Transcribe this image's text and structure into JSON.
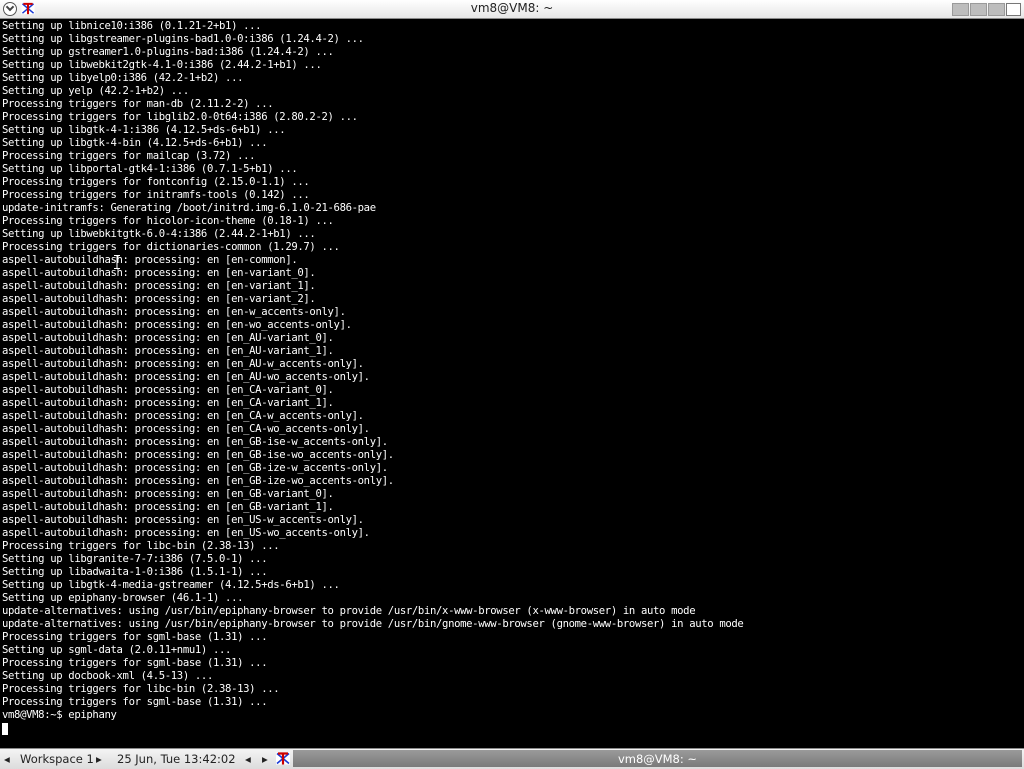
{
  "window": {
    "title": "vm8@VM8: ~"
  },
  "terminal": {
    "lines": [
      "Setting up libnice10:i386 (0.1.21-2+b1) ...",
      "Setting up libgstreamer-plugins-bad1.0-0:i386 (1.24.4-2) ...",
      "Setting up gstreamer1.0-plugins-bad:i386 (1.24.4-2) ...",
      "Setting up libwebkit2gtk-4.1-0:i386 (2.44.2-1+b1) ...",
      "Setting up libyelp0:i386 (42.2-1+b2) ...",
      "Setting up yelp (42.2-1+b2) ...",
      "Processing triggers for man-db (2.11.2-2) ...",
      "Processing triggers for libglib2.0-0t64:i386 (2.80.2-2) ...",
      "Setting up libgtk-4-1:i386 (4.12.5+ds-6+b1) ...",
      "Setting up libgtk-4-bin (4.12.5+ds-6+b1) ...",
      "Processing triggers for mailcap (3.72) ...",
      "Setting up libportal-gtk4-1:i386 (0.7.1-5+b1) ...",
      "Processing triggers for fontconfig (2.15.0-1.1) ...",
      "Processing triggers for initramfs-tools (0.142) ...",
      "update-initramfs: Generating /boot/initrd.img-6.1.0-21-686-pae",
      "Processing triggers for hicolor-icon-theme (0.18-1) ...",
      "Setting up libwebkitgtk-6.0-4:i386 (2.44.2-1+b1) ...",
      "Processing triggers for dictionaries-common (1.29.7) ...",
      "aspell-autobuildhash: processing: en [en-common].",
      "aspell-autobuildhash: processing: en [en-variant_0].",
      "aspell-autobuildhash: processing: en [en-variant_1].",
      "aspell-autobuildhash: processing: en [en-variant_2].",
      "aspell-autobuildhash: processing: en [en-w_accents-only].",
      "aspell-autobuildhash: processing: en [en-wo_accents-only].",
      "aspell-autobuildhash: processing: en [en_AU-variant_0].",
      "aspell-autobuildhash: processing: en [en_AU-variant_1].",
      "aspell-autobuildhash: processing: en [en_AU-w_accents-only].",
      "aspell-autobuildhash: processing: en [en_AU-wo_accents-only].",
      "aspell-autobuildhash: processing: en [en_CA-variant_0].",
      "aspell-autobuildhash: processing: en [en_CA-variant_1].",
      "aspell-autobuildhash: processing: en [en_CA-w_accents-only].",
      "aspell-autobuildhash: processing: en [en_CA-wo_accents-only].",
      "aspell-autobuildhash: processing: en [en_GB-ise-w_accents-only].",
      "aspell-autobuildhash: processing: en [en_GB-ise-wo_accents-only].",
      "aspell-autobuildhash: processing: en [en_GB-ize-w_accents-only].",
      "aspell-autobuildhash: processing: en [en_GB-ize-wo_accents-only].",
      "aspell-autobuildhash: processing: en [en_GB-variant_0].",
      "aspell-autobuildhash: processing: en [en_GB-variant_1].",
      "aspell-autobuildhash: processing: en [en_US-w_accents-only].",
      "aspell-autobuildhash: processing: en [en_US-wo_accents-only].",
      "Processing triggers for libc-bin (2.38-13) ...",
      "Setting up libgranite-7-7:i386 (7.5.0-1) ...",
      "Setting up libadwaita-1-0:i386 (1.5.1-1) ...",
      "Setting up libgtk-4-media-gstreamer (4.12.5+ds-6+b1) ...",
      "Setting up epiphany-browser (46.1-1) ...",
      "update-alternatives: using /usr/bin/epiphany-browser to provide /usr/bin/x-www-browser (x-www-browser) in auto mode",
      "update-alternatives: using /usr/bin/epiphany-browser to provide /usr/bin/gnome-www-browser (gnome-www-browser) in auto mode",
      "Processing triggers for sgml-base (1.31) ...",
      "Setting up sgml-data (2.0.11+nmu1) ...",
      "Processing triggers for sgml-base (1.31) ...",
      "Setting up docbook-xml (4.5-13) ...",
      "Processing triggers for libc-bin (2.38-13) ...",
      "Processing triggers for sgml-base (1.31) ...",
      "vm8@VM8:~$ epiphany"
    ]
  },
  "panel": {
    "workspace_label": "Workspace 1",
    "clock": "25 Jun, Tue 13:42:02",
    "task_title": "vm8@VM8: ~"
  },
  "icons": {
    "window_menu": "chevron-down-icon",
    "app": "terminal-t-icon",
    "prev": "left-arrow-icon",
    "next": "right-arrow-icon"
  },
  "colors": {
    "terminal_bg": "#000000",
    "terminal_fg": "#ffffff",
    "app_icon_red": "#cc0000",
    "app_icon_blue": "#1a3bd6"
  }
}
